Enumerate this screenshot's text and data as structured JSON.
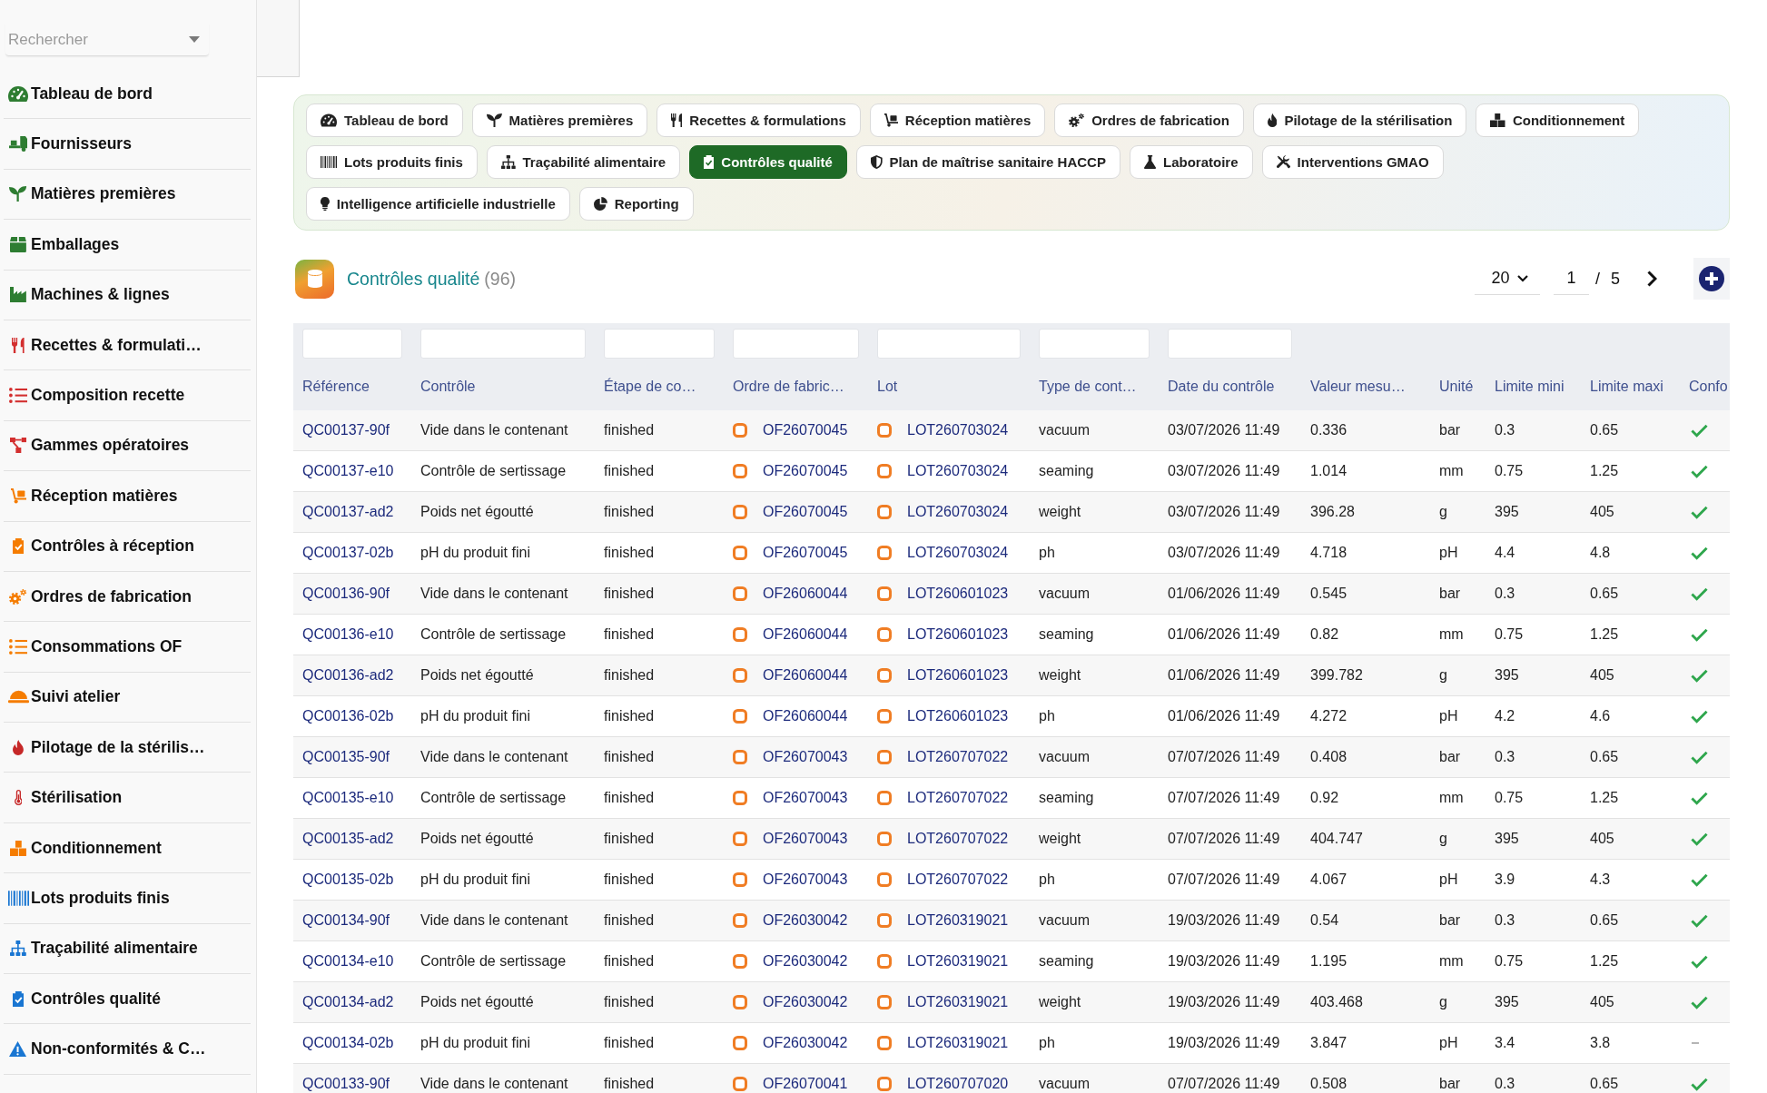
{
  "sidebar": {
    "search": {
      "placeholder": "Rechercher"
    },
    "items": [
      {
        "label": "Tableau de bord",
        "color": "#2e7d32"
      },
      {
        "label": "Fournisseurs",
        "color": "#2e7d32"
      },
      {
        "label": "Matières premières",
        "color": "#2e7d32"
      },
      {
        "label": "Emballages",
        "color": "#2e7d32"
      },
      {
        "label": "Machines & lignes",
        "color": "#2e7d32"
      },
      {
        "label": "Recettes & formulati…",
        "color": "#d32f2f"
      },
      {
        "label": "Composition recette",
        "color": "#d32f2f"
      },
      {
        "label": "Gammes opératoires",
        "color": "#d32f2f"
      },
      {
        "label": "Réception matières",
        "color": "#f57c00"
      },
      {
        "label": "Contrôles à réception",
        "color": "#f57c00"
      },
      {
        "label": "Ordres de fabrication",
        "color": "#f57c00"
      },
      {
        "label": "Consommations OF",
        "color": "#f57c00"
      },
      {
        "label": "Suivi atelier",
        "color": "#f57c00"
      },
      {
        "label": "Pilotage de la stérilis…",
        "color": "#c62828"
      },
      {
        "label": "Stérilisation",
        "color": "#c62828"
      },
      {
        "label": "Conditionnement",
        "color": "#f57c00"
      },
      {
        "label": "Lots produits finis",
        "color": "#1976d2"
      },
      {
        "label": "Traçabilité alimentaire",
        "color": "#1976d2"
      },
      {
        "label": "Contrôles qualité",
        "color": "#1976d2"
      },
      {
        "label": "Non-conformités & C…",
        "color": "#1976d2"
      }
    ]
  },
  "module_tabs": [
    {
      "label": "Tableau de bord",
      "selected": false
    },
    {
      "label": "Matières premières",
      "selected": false
    },
    {
      "label": "Recettes & formulations",
      "selected": false
    },
    {
      "label": "Réception matières",
      "selected": false
    },
    {
      "label": "Ordres de fabrication",
      "selected": false
    },
    {
      "label": "Pilotage de la stérilisation",
      "selected": false
    },
    {
      "label": "Conditionnement",
      "selected": false
    },
    {
      "label": "Lots produits finis",
      "selected": false
    },
    {
      "label": "Traçabilité alimentaire",
      "selected": false
    },
    {
      "label": "Contrôles qualité",
      "selected": true
    },
    {
      "label": "Plan de maîtrise sanitaire HACCP",
      "selected": false
    },
    {
      "label": "Laboratoire",
      "selected": false
    },
    {
      "label": "Interventions GMAO",
      "selected": false
    },
    {
      "label": "Intelligence artificielle industrielle",
      "selected": false
    },
    {
      "label": "Reporting",
      "selected": false
    }
  ],
  "page_header": {
    "title": "Contrôles qualité",
    "count": "(96)",
    "page_size": "20",
    "page": "1",
    "separator": "/",
    "page_count": "5"
  },
  "table": {
    "columns": [
      {
        "label": "Référence",
        "filter": true,
        "kind": "link"
      },
      {
        "label": "Contrôle",
        "filter": true,
        "kind": "text"
      },
      {
        "label": "Étape de co…",
        "filter": true,
        "kind": "text"
      },
      {
        "label": "Ordre de fabric…",
        "filter": true,
        "kind": "record"
      },
      {
        "label": "Lot",
        "filter": true,
        "kind": "record"
      },
      {
        "label": "Type de cont…",
        "filter": true,
        "kind": "text"
      },
      {
        "label": "Date du contrôle",
        "filter": true,
        "kind": "text"
      },
      {
        "label": "Valeur mesu…",
        "filter": false,
        "kind": "text"
      },
      {
        "label": "Unité",
        "filter": false,
        "kind": "text"
      },
      {
        "label": "Limite mini",
        "filter": false,
        "kind": "text"
      },
      {
        "label": "Limite maxi",
        "filter": false,
        "kind": "text"
      },
      {
        "label": "Confo",
        "filter": false,
        "kind": "check"
      }
    ],
    "rows": [
      {
        "cells": [
          "QC00137-90f",
          "Vide dans le contenant",
          "finished",
          "OF26070045",
          "LOT260703024",
          "vacuum",
          "03/07/2026 11:49",
          "0.336",
          "bar",
          "0.3",
          "0.65"
        ],
        "compliant": true
      },
      {
        "cells": [
          "QC00137-e10",
          "Contrôle de sertissage",
          "finished",
          "OF26070045",
          "LOT260703024",
          "seaming",
          "03/07/2026 11:49",
          "1.014",
          "mm",
          "0.75",
          "1.25"
        ],
        "compliant": true
      },
      {
        "cells": [
          "QC00137-ad2",
          "Poids net égoutté",
          "finished",
          "OF26070045",
          "LOT260703024",
          "weight",
          "03/07/2026 11:49",
          "396.28",
          "g",
          "395",
          "405"
        ],
        "compliant": true
      },
      {
        "cells": [
          "QC00137-02b",
          "pH du produit fini",
          "finished",
          "OF26070045",
          "LOT260703024",
          "ph",
          "03/07/2026 11:49",
          "4.718",
          "pH",
          "4.4",
          "4.8"
        ],
        "compliant": true
      },
      {
        "cells": [
          "QC00136-90f",
          "Vide dans le contenant",
          "finished",
          "OF26060044",
          "LOT260601023",
          "vacuum",
          "01/06/2026 11:49",
          "0.545",
          "bar",
          "0.3",
          "0.65"
        ],
        "compliant": true
      },
      {
        "cells": [
          "QC00136-e10",
          "Contrôle de sertissage",
          "finished",
          "OF26060044",
          "LOT260601023",
          "seaming",
          "01/06/2026 11:49",
          "0.82",
          "mm",
          "0.75",
          "1.25"
        ],
        "compliant": true
      },
      {
        "cells": [
          "QC00136-ad2",
          "Poids net égoutté",
          "finished",
          "OF26060044",
          "LOT260601023",
          "weight",
          "01/06/2026 11:49",
          "399.782",
          "g",
          "395",
          "405"
        ],
        "compliant": true
      },
      {
        "cells": [
          "QC00136-02b",
          "pH du produit fini",
          "finished",
          "OF26060044",
          "LOT260601023",
          "ph",
          "01/06/2026 11:49",
          "4.272",
          "pH",
          "4.2",
          "4.6"
        ],
        "compliant": true
      },
      {
        "cells": [
          "QC00135-90f",
          "Vide dans le contenant",
          "finished",
          "OF26070043",
          "LOT260707022",
          "vacuum",
          "07/07/2026 11:49",
          "0.408",
          "bar",
          "0.3",
          "0.65"
        ],
        "compliant": true
      },
      {
        "cells": [
          "QC00135-e10",
          "Contrôle de sertissage",
          "finished",
          "OF26070043",
          "LOT260707022",
          "seaming",
          "07/07/2026 11:49",
          "0.92",
          "mm",
          "0.75",
          "1.25"
        ],
        "compliant": true
      },
      {
        "cells": [
          "QC00135-ad2",
          "Poids net égoutté",
          "finished",
          "OF26070043",
          "LOT260707022",
          "weight",
          "07/07/2026 11:49",
          "404.747",
          "g",
          "395",
          "405"
        ],
        "compliant": true
      },
      {
        "cells": [
          "QC00135-02b",
          "pH du produit fini",
          "finished",
          "OF26070043",
          "LOT260707022",
          "ph",
          "07/07/2026 11:49",
          "4.067",
          "pH",
          "3.9",
          "4.3"
        ],
        "compliant": true
      },
      {
        "cells": [
          "QC00134-90f",
          "Vide dans le contenant",
          "finished",
          "OF26030042",
          "LOT260319021",
          "vacuum",
          "19/03/2026 11:49",
          "0.54",
          "bar",
          "0.3",
          "0.65"
        ],
        "compliant": true
      },
      {
        "cells": [
          "QC00134-e10",
          "Contrôle de sertissage",
          "finished",
          "OF26030042",
          "LOT260319021",
          "seaming",
          "19/03/2026 11:49",
          "1.195",
          "mm",
          "0.75",
          "1.25"
        ],
        "compliant": true
      },
      {
        "cells": [
          "QC00134-ad2",
          "Poids net égoutté",
          "finished",
          "OF26030042",
          "LOT260319021",
          "weight",
          "19/03/2026 11:49",
          "403.468",
          "g",
          "395",
          "405"
        ],
        "compliant": true
      },
      {
        "cells": [
          "QC00134-02b",
          "pH du produit fini",
          "finished",
          "OF26030042",
          "LOT260319021",
          "ph",
          "19/03/2026 11:49",
          "3.847",
          "pH",
          "3.4",
          "3.8"
        ],
        "compliant": false
      },
      {
        "cells": [
          "QC00133-90f",
          "Vide dans le contenant",
          "finished",
          "OF26070041",
          "LOT260707020",
          "vacuum",
          "07/07/2026 11:49",
          "0.508",
          "bar",
          "0.3",
          "0.65"
        ],
        "compliant": true
      }
    ]
  }
}
